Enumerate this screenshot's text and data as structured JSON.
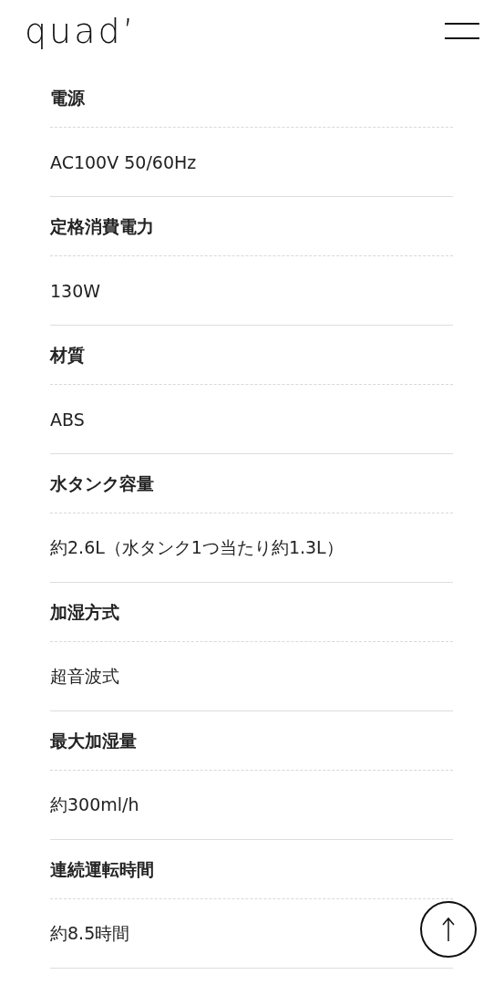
{
  "header": {
    "logo": "quad’"
  },
  "specs": [
    {
      "label": "電源",
      "value": "AC100V 50/60Hz"
    },
    {
      "label": "定格消費電力",
      "value": "130W"
    },
    {
      "label": "材質",
      "value": "ABS"
    },
    {
      "label": "水タンク容量",
      "value": "約2.6L（水タンク1つ当たり約1.3L）"
    },
    {
      "label": "加湿方式",
      "value": "超音波式"
    },
    {
      "label": "最大加湿量",
      "value": "約300ml/h"
    },
    {
      "label": "連続運転時間",
      "value": "約8.5時間"
    }
  ]
}
